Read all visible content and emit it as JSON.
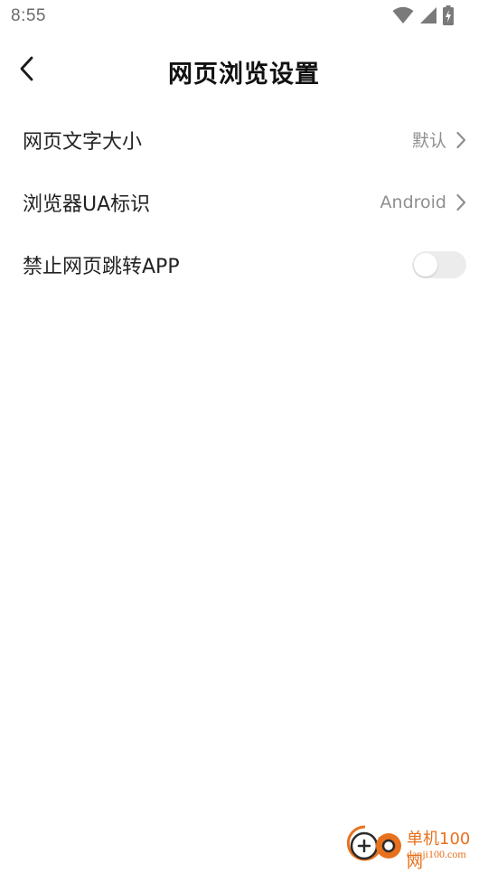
{
  "status_bar": {
    "time": "8:55",
    "icons": [
      "wifi-icon",
      "cellular-signal-icon",
      "battery-charging-icon"
    ]
  },
  "header": {
    "back_icon": "chevron-left-icon",
    "title": "网页浏览设置"
  },
  "settings": {
    "rows": [
      {
        "label": "网页文字大小",
        "value": "默认",
        "control": "chevron"
      },
      {
        "label": "浏览器UA标识",
        "value": "Android",
        "control": "chevron"
      },
      {
        "label": "禁止网页跳转APP",
        "control": "toggle",
        "toggle_on": false
      }
    ]
  },
  "watermark": {
    "title": "单机100网",
    "url": "danji100.com"
  },
  "colors": {
    "background": "#ffffff",
    "text_primary": "#222222",
    "text_secondary": "#8f8f8f",
    "toggle_off_track": "#ececec",
    "watermark_orange": "#e8711d"
  }
}
